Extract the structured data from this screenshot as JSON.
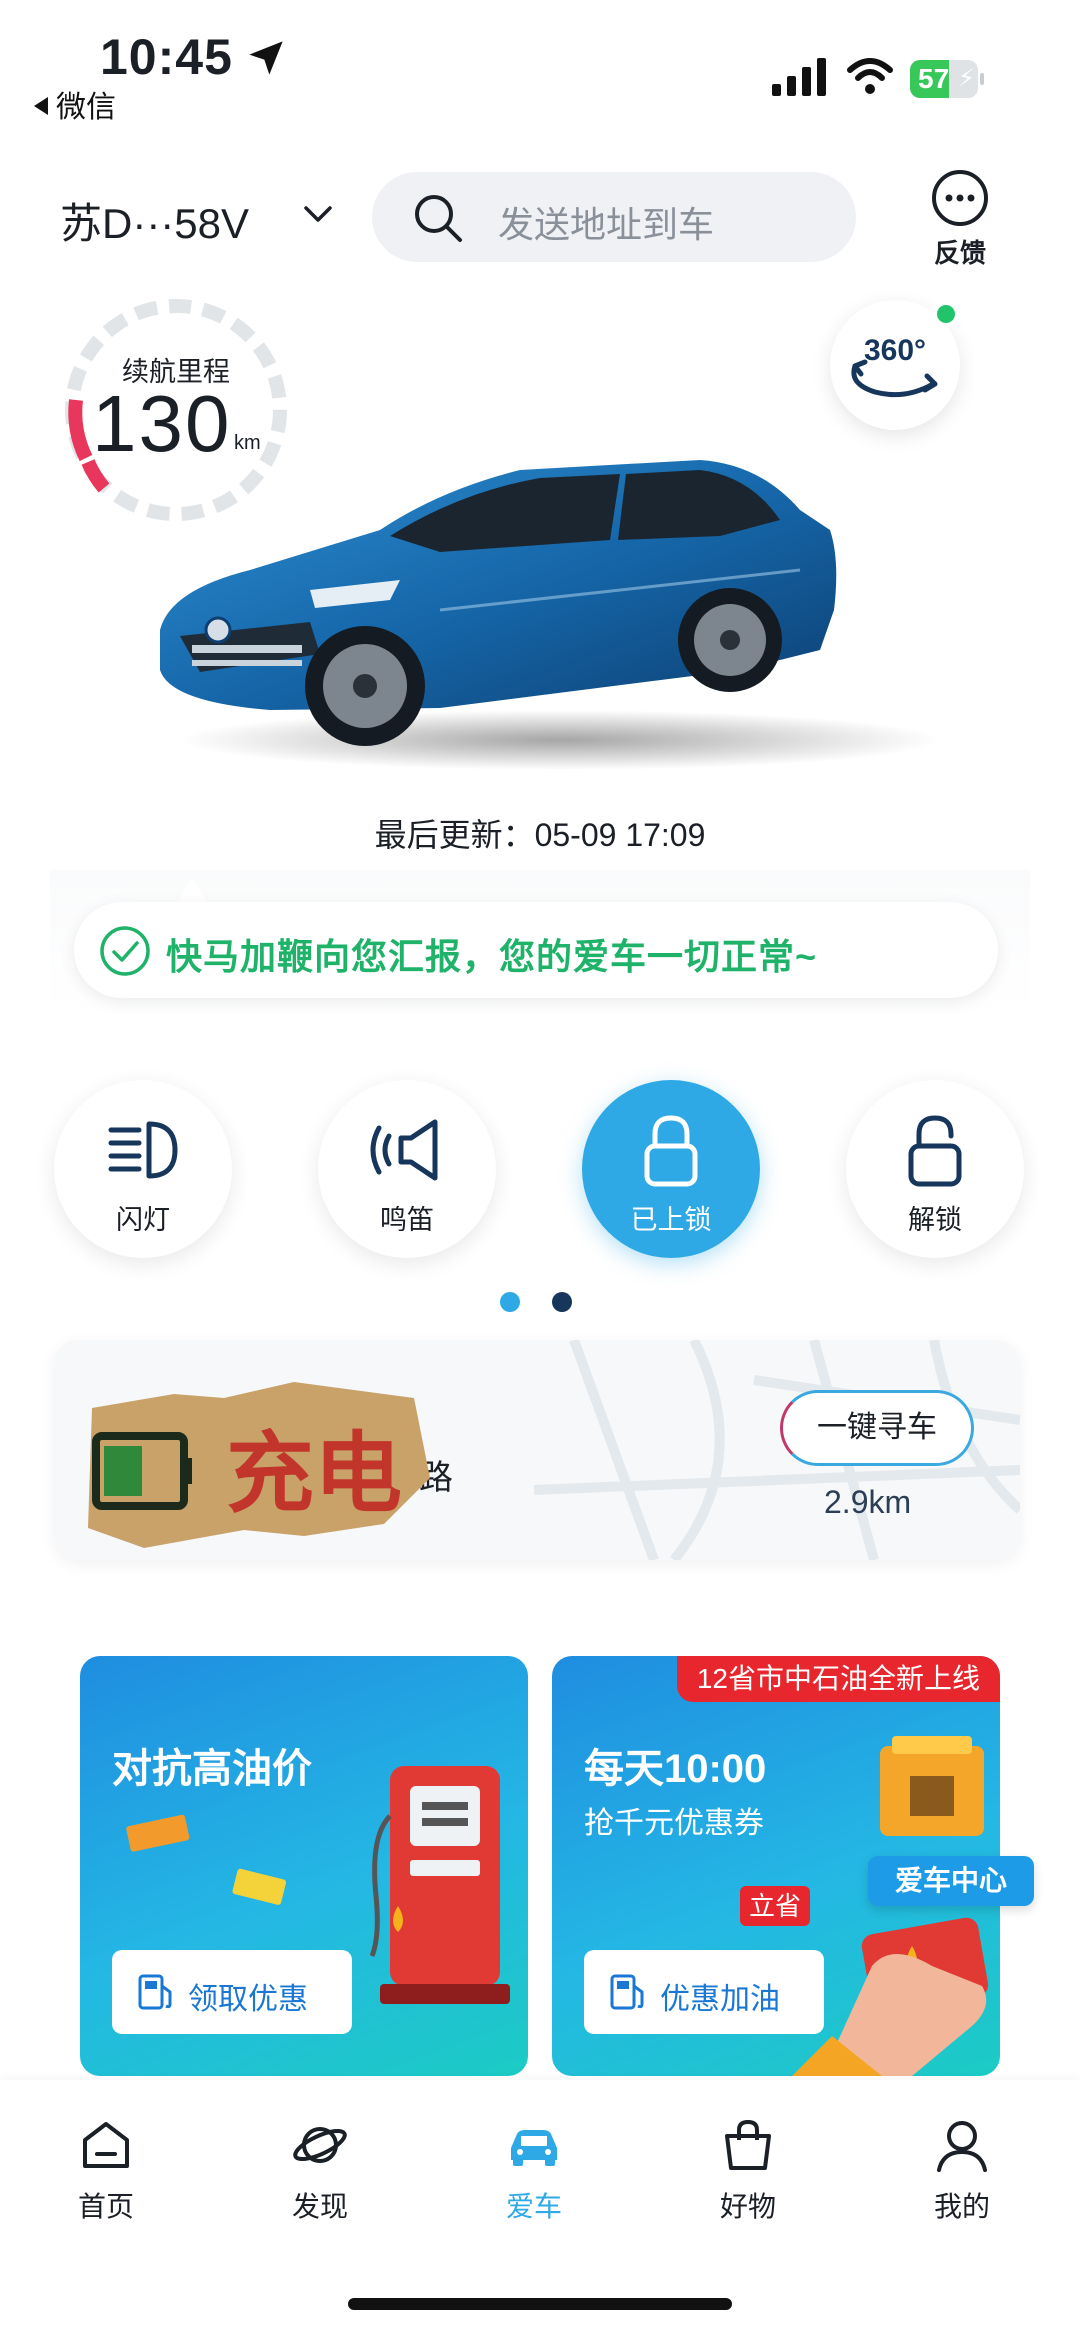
{
  "status_bar": {
    "time": "10:45",
    "back_label": "微信",
    "battery": "57"
  },
  "header": {
    "plate": "苏D···58V",
    "search_placeholder": "发送地址到车",
    "feedback_label": "反馈"
  },
  "range": {
    "label": "续航里程",
    "value": "130",
    "unit": "km"
  },
  "view360": {
    "label": "360°"
  },
  "updated": "最后更新：05-09 17:09",
  "message": "快马加鞭向您汇报，您的爱车一切正常~",
  "controls": [
    {
      "label": "闪灯",
      "icon": "headlight-icon"
    },
    {
      "label": "鸣笛",
      "icon": "horn-icon"
    },
    {
      "label": "已上锁",
      "icon": "lock-icon",
      "active": true
    },
    {
      "label": "解锁",
      "icon": "unlock-icon"
    }
  ],
  "pager": {
    "count": 2,
    "current": 1
  },
  "find_car": {
    "address_fragment": "路",
    "button_label": "一键寻车",
    "distance": "2.9km",
    "sticker_text": "充电"
  },
  "promos": [
    {
      "title": "对抗高油价",
      "button_label": "领取优惠"
    },
    {
      "title": "每天10:00",
      "subtitle": "抢千元优惠券",
      "tag": "12省市中石油全新上线",
      "button_label": "优惠加油",
      "badge": "立省"
    }
  ],
  "center_badge": "爱车中心",
  "tabbar": [
    {
      "label": "首页",
      "icon": "home-icon"
    },
    {
      "label": "发现",
      "icon": "planet-icon"
    },
    {
      "label": "爱车",
      "icon": "car-icon",
      "active": true
    },
    {
      "label": "好物",
      "icon": "bag-icon"
    },
    {
      "label": "我的",
      "icon": "user-icon"
    }
  ],
  "colors": {
    "accent": "#2fa9e6",
    "success": "#1fb36a",
    "gauge_low": "#e8365d",
    "promo_red": "#e8262d"
  }
}
